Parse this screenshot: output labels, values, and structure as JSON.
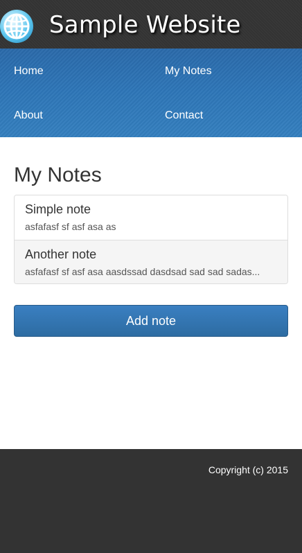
{
  "header": {
    "logo_icon": "globe-icon",
    "title": "Sample Website"
  },
  "nav": {
    "items": [
      {
        "label": "Home"
      },
      {
        "label": "My Notes"
      },
      {
        "label": "About"
      },
      {
        "label": "Contact"
      }
    ]
  },
  "main": {
    "title": "My Notes",
    "notes": [
      {
        "title": "Simple note",
        "body": "asfafasf sf asf asa as"
      },
      {
        "title": "Another note",
        "body": "asfafasf sf asf asa aasdssad dasdsad sad sad sadas..."
      }
    ],
    "add_label": "Add note"
  },
  "footer": {
    "copyright": "Copyright (c) 2015"
  },
  "colors": {
    "header_bg": "#333333",
    "nav_bg": "#2e76b8",
    "button_bg": "#337ab7",
    "footer_bg": "#333333"
  }
}
